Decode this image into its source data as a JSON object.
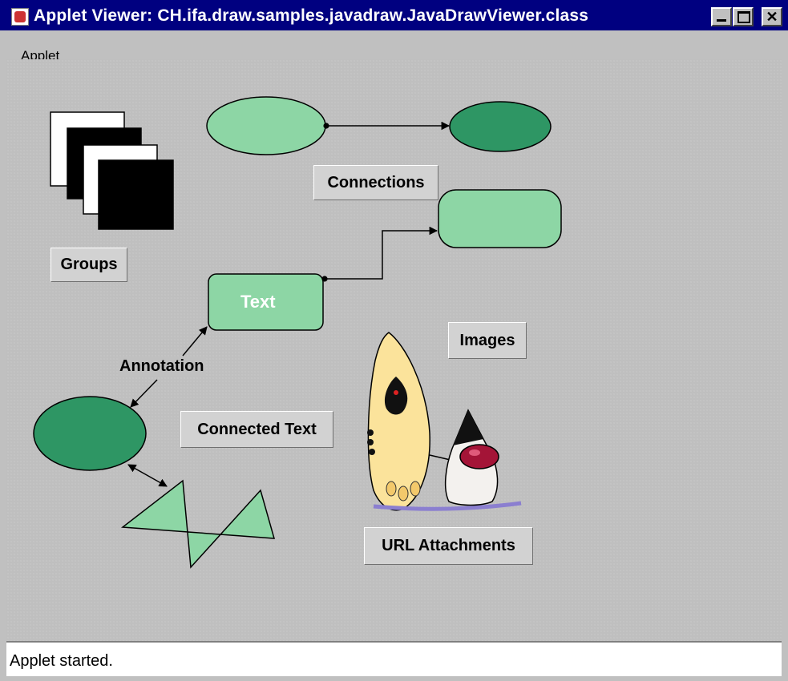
{
  "window": {
    "title": "Applet Viewer: CH.ifa.draw.samples.javadraw.JavaDrawViewer.class",
    "minimize_icon": "minimize-icon",
    "maximize_icon": "maximize-icon",
    "close_icon": "close-icon",
    "close_glyph": "✕"
  },
  "menubar": {
    "items": [
      {
        "label": "Applet"
      }
    ]
  },
  "canvas": {
    "labels": {
      "groups": "Groups",
      "connections": "Connections",
      "text": "Text",
      "annotation": "Annotation",
      "connected_text": "Connected Text",
      "images": "Images",
      "url_attachments": "URL Attachments"
    },
    "colors": {
      "light_green": "#8dd6a5",
      "dark_green": "#2e9664",
      "label_bg": "#d2d2d2"
    },
    "images": [
      "surfboard-image",
      "duke-mascot-image"
    ]
  },
  "status": {
    "text": "Applet started."
  }
}
